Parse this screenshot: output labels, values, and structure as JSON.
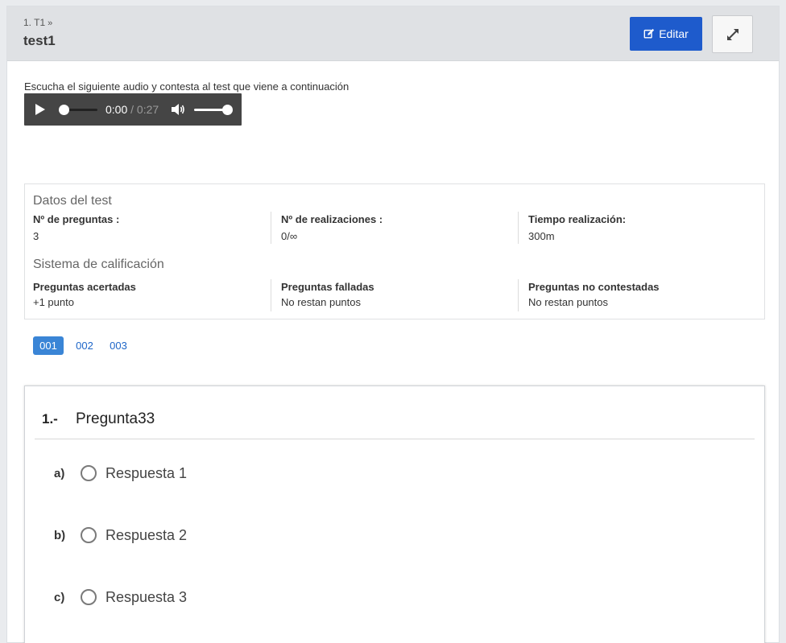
{
  "header": {
    "breadcrumb": "1. T1",
    "breadcrumb_chevron": "»",
    "title": "test1",
    "edit_label": "Editar"
  },
  "instructions": "Escucha el siguiente audio y contesta al test que viene a continuación",
  "audio": {
    "current_time": "0:00",
    "separator": "/",
    "duration": "0:27",
    "progress": 0,
    "volume": 1.0
  },
  "test_data": {
    "title": "Datos del test",
    "fields": [
      {
        "label": "Nº de preguntas :",
        "value": "3"
      },
      {
        "label": "Nº de realizaciones :",
        "value": "0/∞"
      },
      {
        "label": "Tiempo realización:",
        "value": "300m"
      }
    ]
  },
  "grading": {
    "title": "Sistema de calificación",
    "fields": [
      {
        "label": "Preguntas acertadas",
        "value": "+1 punto"
      },
      {
        "label": "Preguntas falladas",
        "value": "No restan puntos"
      },
      {
        "label": "Preguntas no contestadas",
        "value": "No restan puntos"
      }
    ]
  },
  "pager": {
    "pages": [
      "001",
      "002",
      "003"
    ],
    "active": "001"
  },
  "question": {
    "number": "1.-",
    "text": "Pregunta33",
    "answers": [
      {
        "letter": "a)",
        "text": "Respuesta 1"
      },
      {
        "letter": "b)",
        "text": "Respuesta 2"
      },
      {
        "letter": "c)",
        "text": "Respuesta 3"
      }
    ]
  },
  "colors": {
    "primary_button": "#1e5bcc",
    "active_page": "#3a85d6",
    "header_bg": "#dfe1e4",
    "audio_bg": "#454545"
  },
  "icons": {
    "edit": "edit-icon",
    "expand": "expand-icon",
    "play": "play-icon",
    "volume": "volume-icon"
  }
}
